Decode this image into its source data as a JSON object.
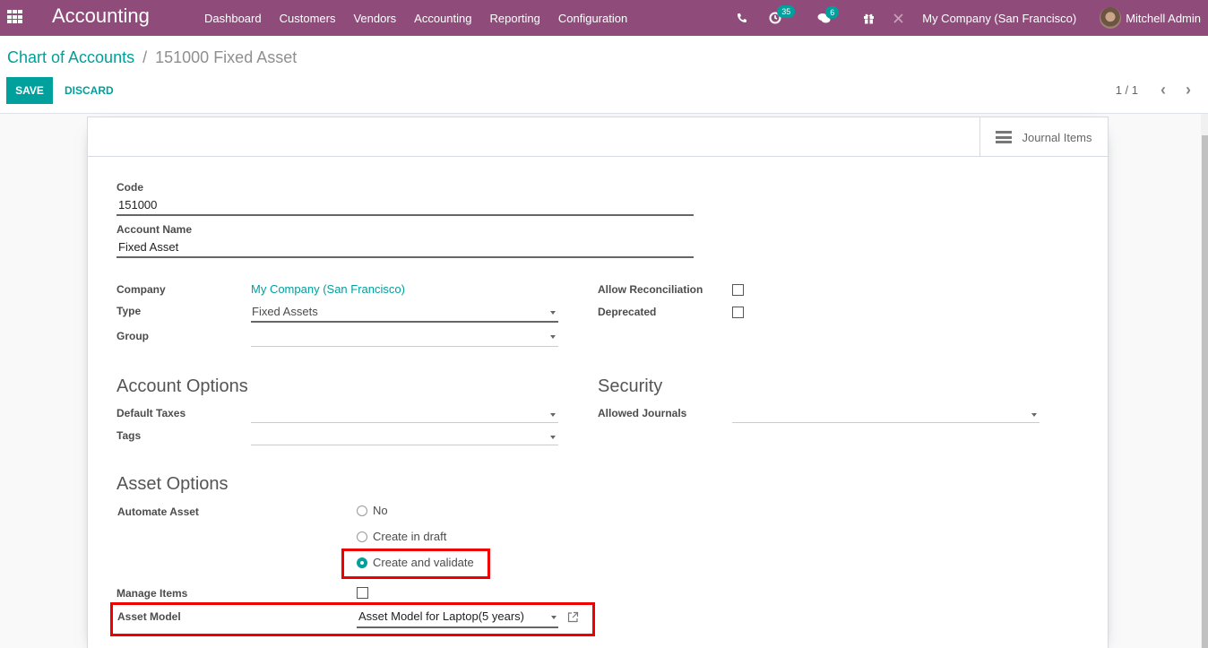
{
  "navbar": {
    "app_title": "Accounting",
    "menu": [
      "Dashboard",
      "Customers",
      "Vendors",
      "Accounting",
      "Reporting",
      "Configuration"
    ],
    "activity_count": "35",
    "message_count": "6",
    "company": "My Company (San Francisco)",
    "user": "Mitchell Admin",
    "icons": [
      "apps-icon",
      "phone-icon",
      "clock-icon",
      "chat-icon",
      "gift-icon",
      "debug-icon"
    ]
  },
  "control_panel": {
    "breadcrumb_parent": "Chart of Accounts",
    "breadcrumb_separator": "/",
    "breadcrumb_current": "151000 Fixed Asset",
    "save_label": "SAVE",
    "discard_label": "DISCARD",
    "pager": "1 / 1"
  },
  "sheet": {
    "journal_items_label": "Journal Items",
    "code_label": "Code",
    "code_value": "151000",
    "name_label": "Account Name",
    "name_value": "Fixed Asset",
    "company_label": "Company",
    "company_value": "My Company (San Francisco)",
    "type_label": "Type",
    "type_value": "Fixed Assets",
    "group_label": "Group",
    "group_value": "",
    "allow_reconciliation_label": "Allow Reconciliation",
    "allow_reconciliation_checked": false,
    "deprecated_label": "Deprecated",
    "deprecated_checked": false,
    "account_options_title": "Account Options",
    "default_taxes_label": "Default Taxes",
    "tags_label": "Tags",
    "security_title": "Security",
    "allowed_journals_label": "Allowed Journals",
    "asset_options_title": "Asset Options",
    "automate_asset_label": "Automate Asset",
    "automate_asset_options": [
      {
        "label": "No",
        "checked": false
      },
      {
        "label": "Create in draft",
        "checked": false
      },
      {
        "label": "Create and validate",
        "checked": true
      }
    ],
    "manage_items_label": "Manage Items",
    "manage_items_checked": false,
    "asset_model_label": "Asset Model",
    "asset_model_value": "Asset Model for Laptop(5 years)"
  },
  "colors": {
    "navbar": "#8f4c7b",
    "accent": "#00a09d",
    "highlight": "#ee0000"
  }
}
